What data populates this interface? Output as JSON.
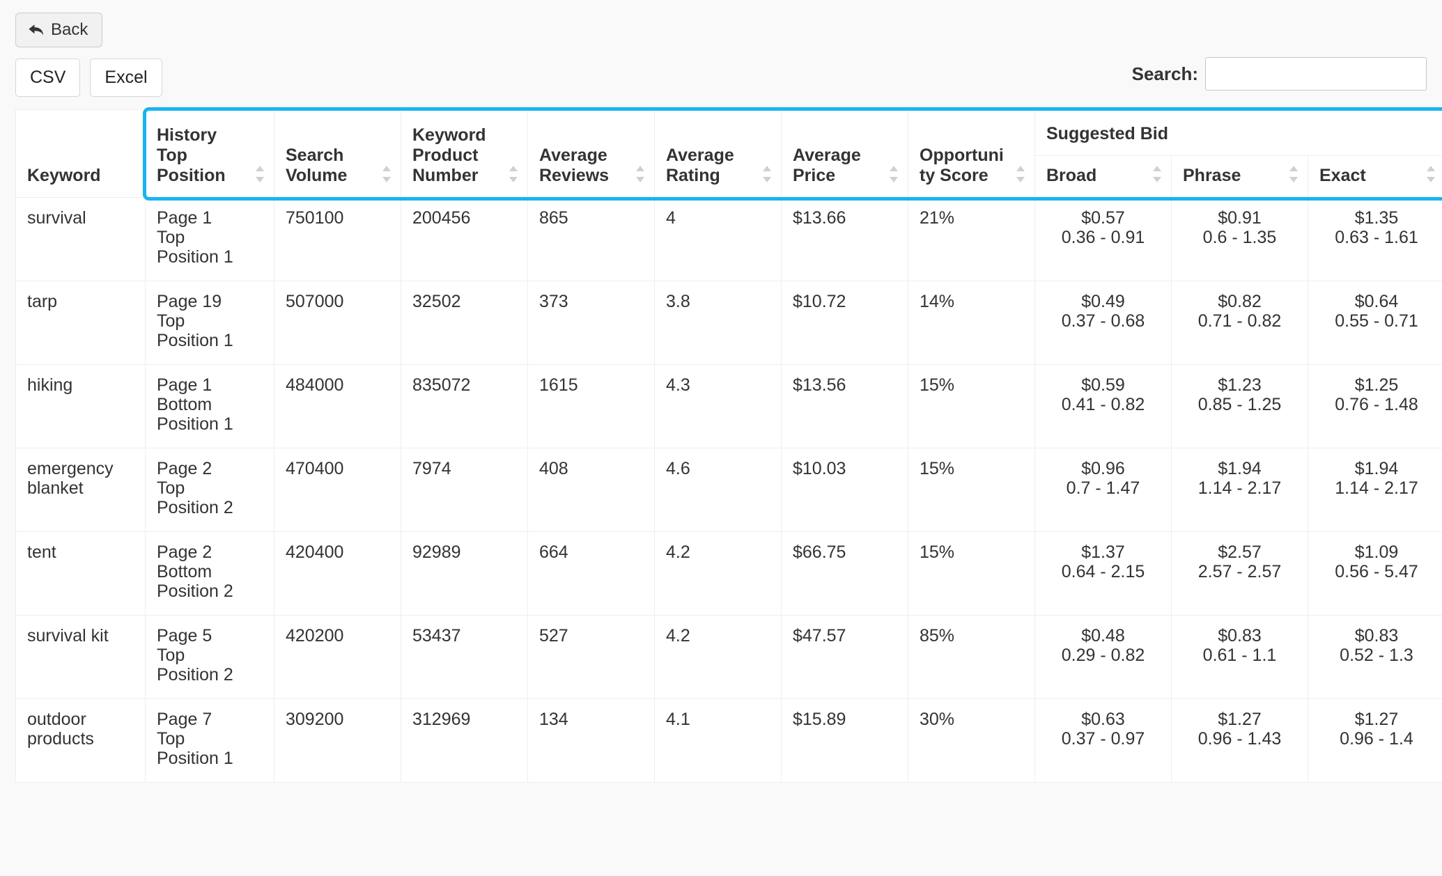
{
  "toolbar": {
    "back_label": "Back",
    "back_icon": "back-arrow-icon",
    "csv_label": "CSV",
    "excel_label": "Excel"
  },
  "search": {
    "label": "Search:",
    "value": "",
    "placeholder": ""
  },
  "table": {
    "group_header": {
      "suggested_bid": "Suggested Bid"
    },
    "columns": [
      {
        "key": "keyword",
        "label": "Keyword",
        "sortable": false
      },
      {
        "key": "history_top_position",
        "label": "History Top Position",
        "sortable": true
      },
      {
        "key": "search_volume",
        "label": "Search Volume",
        "sortable": true
      },
      {
        "key": "keyword_product_number",
        "label": "Keyword Product Number",
        "sortable": true
      },
      {
        "key": "average_reviews",
        "label": "Average Reviews",
        "sortable": true
      },
      {
        "key": "average_rating",
        "label": "Average Rating",
        "sortable": true
      },
      {
        "key": "average_price",
        "label": "Average Price",
        "sortable": true
      },
      {
        "key": "opportunity_score",
        "label": "Opportuni ty Score",
        "sortable": true
      },
      {
        "key": "bid_broad",
        "label": "Broad",
        "sortable": true
      },
      {
        "key": "bid_phrase",
        "label": "Phrase",
        "sortable": true
      },
      {
        "key": "bid_exact",
        "label": "Exact",
        "sortable": true
      }
    ],
    "rows": [
      {
        "keyword": "survival",
        "history_page": "Page 1",
        "history_place": "Top",
        "history_position": "Position 1",
        "search_volume": "750100",
        "keyword_product_number": "200456",
        "average_reviews": "865",
        "average_rating": "4",
        "average_price": "$13.66",
        "opportunity_score": "21%",
        "bid_broad": "$0.57",
        "bid_broad_range": "0.36 - 0.91",
        "bid_phrase": "$0.91",
        "bid_phrase_range": "0.6 - 1.35",
        "bid_exact": "$1.35",
        "bid_exact_range": "0.63 - 1.61"
      },
      {
        "keyword": "tarp",
        "history_page": "Page 19",
        "history_place": "Top",
        "history_position": "Position 1",
        "search_volume": "507000",
        "keyword_product_number": "32502",
        "average_reviews": "373",
        "average_rating": "3.8",
        "average_price": "$10.72",
        "opportunity_score": "14%",
        "bid_broad": "$0.49",
        "bid_broad_range": "0.37 - 0.68",
        "bid_phrase": "$0.82",
        "bid_phrase_range": "0.71 - 0.82",
        "bid_exact": "$0.64",
        "bid_exact_range": "0.55 - 0.71"
      },
      {
        "keyword": "hiking",
        "history_page": "Page 1",
        "history_place": "Bottom",
        "history_position": "Position 1",
        "search_volume": "484000",
        "keyword_product_number": "835072",
        "average_reviews": "1615",
        "average_rating": "4.3",
        "average_price": "$13.56",
        "opportunity_score": "15%",
        "bid_broad": "$0.59",
        "bid_broad_range": "0.41 - 0.82",
        "bid_phrase": "$1.23",
        "bid_phrase_range": "0.85 - 1.25",
        "bid_exact": "$1.25",
        "bid_exact_range": "0.76 - 1.48"
      },
      {
        "keyword": "emergency blanket",
        "history_page": "Page 2",
        "history_place": "Top",
        "history_position": "Position 2",
        "search_volume": "470400",
        "keyword_product_number": "7974",
        "average_reviews": "408",
        "average_rating": "4.6",
        "average_price": "$10.03",
        "opportunity_score": "15%",
        "bid_broad": "$0.96",
        "bid_broad_range": "0.7 - 1.47",
        "bid_phrase": "$1.94",
        "bid_phrase_range": "1.14 - 2.17",
        "bid_exact": "$1.94",
        "bid_exact_range": "1.14 - 2.17"
      },
      {
        "keyword": "tent",
        "history_page": "Page 2",
        "history_place": "Bottom",
        "history_position": "Position 2",
        "search_volume": "420400",
        "keyword_product_number": "92989",
        "average_reviews": "664",
        "average_rating": "4.2",
        "average_price": "$66.75",
        "opportunity_score": "15%",
        "bid_broad": "$1.37",
        "bid_broad_range": "0.64 - 2.15",
        "bid_phrase": "$2.57",
        "bid_phrase_range": "2.57 - 2.57",
        "bid_exact": "$1.09",
        "bid_exact_range": "0.56 - 5.47"
      },
      {
        "keyword": "survival kit",
        "history_page": "Page 5",
        "history_place": "Top",
        "history_position": "Position 2",
        "search_volume": "420200",
        "keyword_product_number": "53437",
        "average_reviews": "527",
        "average_rating": "4.2",
        "average_price": "$47.57",
        "opportunity_score": "85%",
        "bid_broad": "$0.48",
        "bid_broad_range": "0.29 - 0.82",
        "bid_phrase": "$0.83",
        "bid_phrase_range": "0.61 - 1.1",
        "bid_exact": "$0.83",
        "bid_exact_range": "0.52 - 1.3"
      },
      {
        "keyword": "outdoor products",
        "history_page": "Page 7",
        "history_place": "Top",
        "history_position": "Position 1",
        "search_volume": "309200",
        "keyword_product_number": "312969",
        "average_reviews": "134",
        "average_rating": "4.1",
        "average_price": "$15.89",
        "opportunity_score": "30%",
        "bid_broad": "$0.63",
        "bid_broad_range": "0.37 - 0.97",
        "bid_phrase": "$1.27",
        "bid_phrase_range": "0.96 - 1.43",
        "bid_exact": "$1.27",
        "bid_exact_range": "0.96 - 1.4"
      }
    ]
  },
  "highlight": {
    "color": "#18b4f0"
  }
}
